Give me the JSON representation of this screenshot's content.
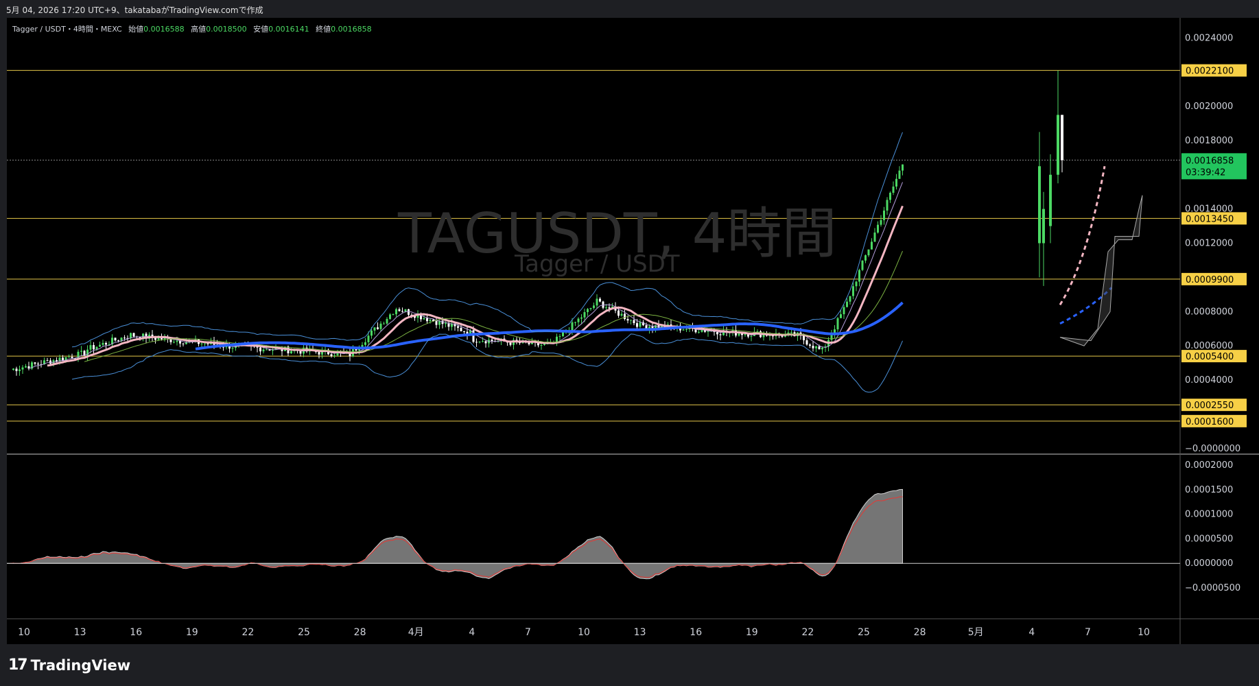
{
  "header": {
    "info": "5月 04, 2026 17:20 UTC+9、takatabaがTradingView.comで作成"
  },
  "legend": {
    "symbol": "Tagger / USDT・4時間・MEXC",
    "open_label": "始値",
    "open": "0.0016588",
    "high_label": "高値",
    "high": "0.0018500",
    "low_label": "安値",
    "low": "0.0016141",
    "close_label": "終値",
    "close": "0.0016858"
  },
  "watermark": {
    "title": "TAGUSDT, 4時間",
    "subtitle": "Tagger / USDT"
  },
  "price_axis": {
    "ticks": [
      "0.0024000",
      "0.0020000",
      "0.0018000",
      "0.0014000",
      "0.0012000",
      "0.0008000",
      "0.0006000",
      "0.0004000",
      "−0.0000000"
    ]
  },
  "levels": [
    {
      "label": "0.0022100",
      "value": 0.00221
    },
    {
      "label": "0.0013450",
      "value": 0.001345
    },
    {
      "label": "0.0009900",
      "value": 0.00099
    },
    {
      "label": "0.0005400",
      "value": 0.00054
    },
    {
      "label": "0.0002550",
      "value": 0.000255
    },
    {
      "label": "0.0001600",
      "value": 0.00016
    }
  ],
  "current_price": {
    "label": "0.0016858",
    "countdown": "03:39:42",
    "value": 0.0016858
  },
  "indicator_axis": {
    "ticks": [
      "0.0002000",
      "0.0001500",
      "0.0001000",
      "0.0000500",
      "0.0000000",
      "−0.0000500"
    ]
  },
  "time_axis": {
    "ticks": [
      "10",
      "13",
      "16",
      "19",
      "22",
      "25",
      "28",
      "4月",
      "4",
      "7",
      "10",
      "13",
      "16",
      "19",
      "22",
      "25",
      "28",
      "5月",
      "4",
      "7",
      "10"
    ]
  },
  "colors": {
    "up": "#4cd964",
    "down": "#ffffff",
    "level": "#e6c84a",
    "current": "#22c55e",
    "ma_blue": "#2962ff",
    "ma_pink": "#f4b6c2",
    "bollinger": "#4a90d9"
  },
  "brand": {
    "name": "TradingView",
    "logo": "17"
  }
}
